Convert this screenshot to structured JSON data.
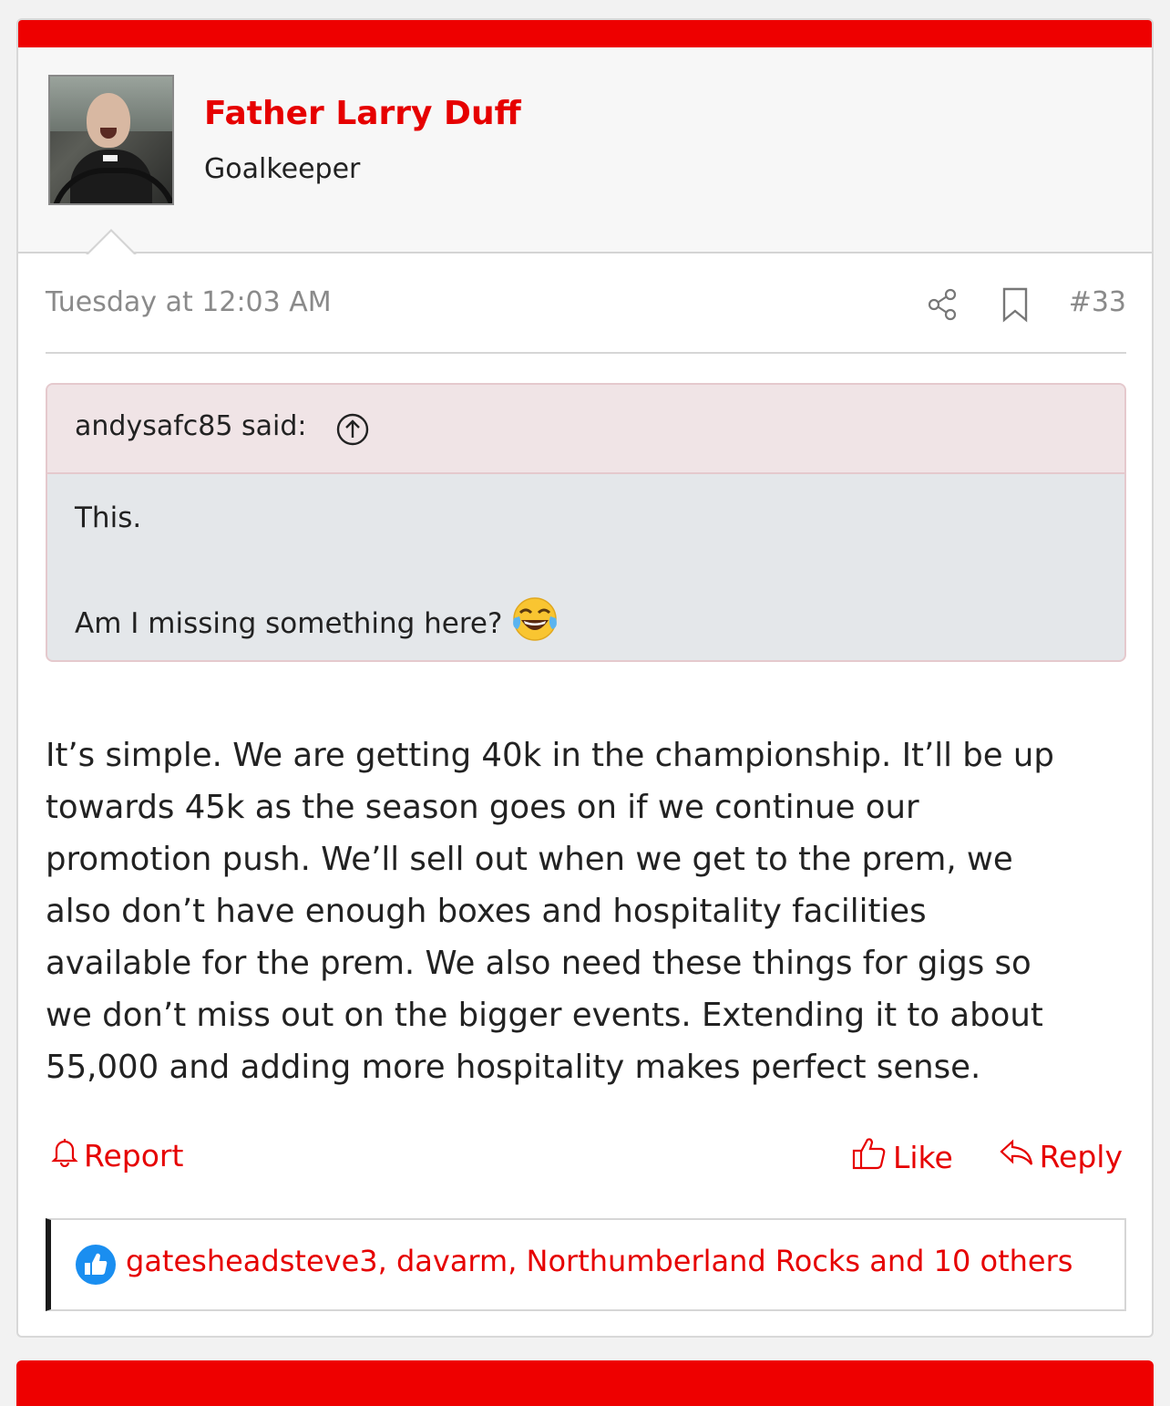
{
  "post": {
    "author": {
      "name": "Father Larry Duff",
      "title": "Goalkeeper"
    },
    "timestamp": "Tuesday at 12:03 AM",
    "number": "#33",
    "quote": {
      "author_label": "andysafc85 said:",
      "lines": [
        "This.",
        "Am I missing something here?"
      ],
      "emoji": "face-with-tears-of-joy"
    },
    "message_lines": [
      "It’s simple. We are getting 40k in the championship. It’ll be up",
      "towards 45k as the season goes on if we continue our",
      "promotion push. We’ll sell out when we get to the prem, we",
      "also don’t have enough boxes and hospitality facilities",
      "available for the prem. We also need these things for gigs so",
      "we don’t miss out on the bigger events. Extending it to about",
      "55,000 and adding more hospitality makes perfect sense."
    ],
    "actions": {
      "report": "Report",
      "like": "Like",
      "reply": "Reply"
    },
    "reactions": "gatesheadsteve3, davarm, Northumberland Rocks and 10 others"
  },
  "colors": {
    "accent": "#e60000",
    "top_bar": "#ee0000",
    "quote_header_bg": "#f0e4e6",
    "quote_body_bg": "#e4e7ea",
    "like_icon_blue": "#1a8ef0"
  },
  "icons": [
    "share-icon",
    "bookmark-icon",
    "arrow-up-circle-icon",
    "bell-icon",
    "thumbs-up-icon",
    "reply-arrow-icon",
    "like-reaction-icon"
  ]
}
